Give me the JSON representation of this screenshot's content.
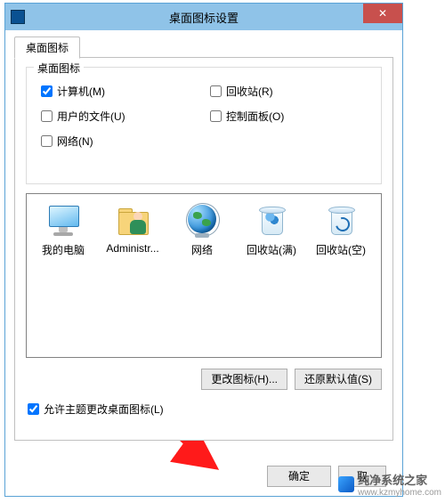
{
  "window": {
    "title": "桌面图标设置"
  },
  "tab": {
    "label": "桌面图标"
  },
  "group": {
    "title": "桌面图标",
    "checks": {
      "computer": {
        "label": "计算机(M)",
        "checked": true
      },
      "recycle": {
        "label": "回收站(R)",
        "checked": false
      },
      "userfiles": {
        "label": "用户的文件(U)",
        "checked": false
      },
      "control": {
        "label": "控制面板(O)",
        "checked": false
      },
      "network": {
        "label": "网络(N)",
        "checked": false
      }
    }
  },
  "preview": {
    "items": [
      {
        "label": "我的电脑"
      },
      {
        "label": "Administr..."
      },
      {
        "label": "网络"
      },
      {
        "label": "回收站(满)"
      },
      {
        "label": "回收站(空)"
      }
    ]
  },
  "buttons": {
    "changeIcon": "更改图标(H)...",
    "restoreDefault": "还原默认值(S)",
    "ok": "确定",
    "cancel": "取"
  },
  "allowThemes": {
    "label": "允许主题更改桌面图标(L)",
    "checked": true
  },
  "watermark": {
    "text": "纯净系统之家",
    "url": "www.kzmyhome.com"
  }
}
